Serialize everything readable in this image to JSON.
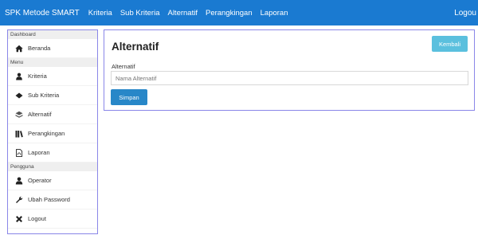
{
  "navbar": {
    "brand": "SPK Metode SMART",
    "links": [
      "Kriteria",
      "Sub Kriteria",
      "Alternatif",
      "Perangkingan",
      "Laporan"
    ],
    "logout": "Logou"
  },
  "sidebar": {
    "sections": {
      "dashboard": "Dashboard",
      "menu": "Menu",
      "pengguna": "Pengguna"
    },
    "items": {
      "beranda": {
        "label": "Beranda",
        "icon": "home-icon"
      },
      "kriteria": {
        "label": "Kriteria",
        "icon": "user-icon"
      },
      "sub_kriteria": {
        "label": "Sub Kriteria",
        "icon": "diamond-icon"
      },
      "alternatif": {
        "label": "Alternatif",
        "icon": "layers-icon"
      },
      "perangkingan": {
        "label": "Perangkingan",
        "icon": "books-icon"
      },
      "laporan": {
        "label": "Laporan",
        "icon": "file-icon"
      },
      "operator": {
        "label": "Operator",
        "icon": "person-icon"
      },
      "ubah_password": {
        "label": "Ubah Password",
        "icon": "wrench-icon"
      },
      "logout": {
        "label": "Logout",
        "icon": "close-icon"
      }
    }
  },
  "form": {
    "title": "Alternatif",
    "back_label": "Kembali",
    "field_label": "Alternatif",
    "placeholder": "Nama Alternatif",
    "value": "",
    "save_label": "Simpan"
  }
}
